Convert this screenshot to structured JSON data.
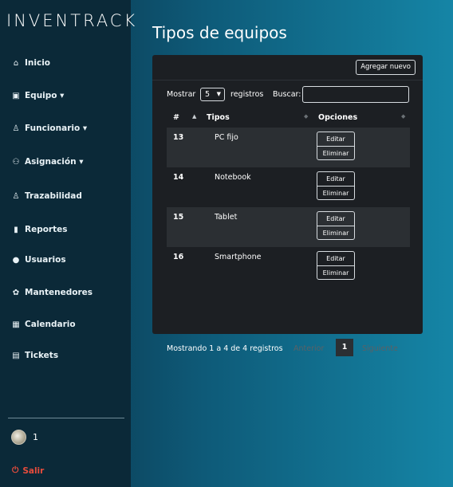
{
  "brand": "INVENTRACK",
  "sidebar": {
    "items": [
      {
        "icon": "home-icon",
        "glyph": "⌂",
        "label": "Inicio"
      },
      {
        "icon": "equipment-icon",
        "glyph": "▣",
        "label": "Equipo ▾"
      },
      {
        "icon": "user-icon",
        "glyph": "♙",
        "label": "Funcionario ▾"
      },
      {
        "icon": "users-icon",
        "glyph": "⚇",
        "label": "Asignación ▾"
      },
      {
        "icon": "trace-icon",
        "glyph": "♙",
        "label": "Trazabilidad"
      },
      {
        "icon": "report-icon",
        "glyph": "▮",
        "label": "Reportes"
      },
      {
        "icon": "user-solid-icon",
        "glyph": "●",
        "label": "Usuarios"
      },
      {
        "icon": "settings-icon",
        "glyph": "✿",
        "label": "Mantenedores"
      },
      {
        "icon": "calendar-icon",
        "glyph": "▦",
        "label": "Calendario"
      },
      {
        "icon": "ticket-icon",
        "glyph": "▤",
        "label": "Tickets"
      }
    ],
    "user": {
      "name": "1"
    },
    "logout": {
      "glyph": "⏻",
      "label": "Salir"
    }
  },
  "main": {
    "title": "Tipos de equipos",
    "add_button": "Agregar nuevo",
    "show_label": "Mostrar",
    "page_size": "5",
    "records_label": "registros",
    "search_label": "Buscar:",
    "search_value": "",
    "columns": [
      "#",
      "Tipos",
      "Opciones"
    ],
    "rows": [
      {
        "num": "13",
        "tipo": "PC fijo",
        "edit": "Editar",
        "delete": "Eliminar"
      },
      {
        "num": "14",
        "tipo": "Notebook",
        "edit": "Editar",
        "delete": "Eliminar"
      },
      {
        "num": "15",
        "tipo": "Tablet",
        "edit": "Editar",
        "delete": "Eliminar"
      },
      {
        "num": "16",
        "tipo": "Smartphone",
        "edit": "Editar",
        "delete": "Eliminar"
      }
    ],
    "info": "Mostrando 1 a 4 de 4 registros",
    "prev": "Anterior",
    "page": "1",
    "next": "Siguiente"
  }
}
